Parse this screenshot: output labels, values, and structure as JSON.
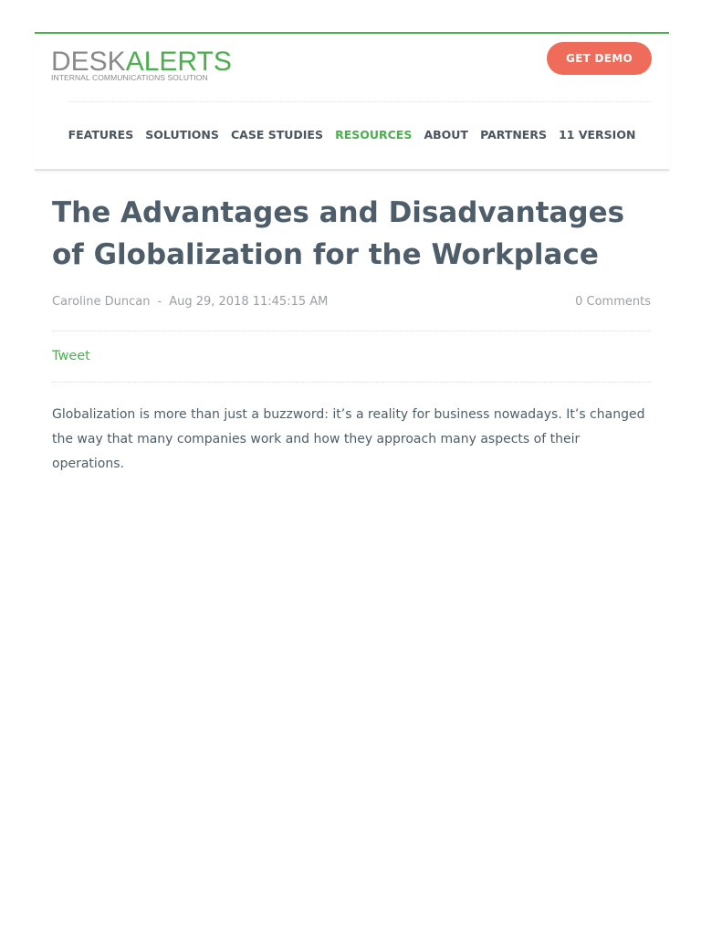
{
  "header": {
    "logo": {
      "word_gray": "DESK",
      "word_green": "ALERTS",
      "tagline": "INTERNAL COMMUNICATIONS SOLUTION"
    },
    "demo_button": "GET DEMO",
    "nav": [
      {
        "label": "FEATURES",
        "active": false
      },
      {
        "label": "SOLUTIONS",
        "active": false
      },
      {
        "label": "CASE STUDIES",
        "active": false
      },
      {
        "label": "RESOURCES",
        "active": true
      },
      {
        "label": "ABOUT",
        "active": false
      },
      {
        "label": "PARTNERS",
        "active": false
      },
      {
        "label": "11 VERSION",
        "active": false
      }
    ]
  },
  "article": {
    "title": "The Advantages and Disadvantages of Globalization for the Workplace",
    "author": "Caroline Duncan",
    "separator": "-",
    "date": "Aug 29, 2018 11:45:15 AM",
    "comments": "0 Comments",
    "tweet": "Tweet",
    "body": "Globalization is more than just a buzzword: it’s a reality for business nowadays. It’s changed the way that many companies work and how they approach many aspects of their operations."
  },
  "colors": {
    "brand_green": "#4cae4f",
    "cta_coral": "#ef6b5a",
    "heading_slate": "#4d5d6a",
    "meta_gray": "#9aa0a6"
  }
}
